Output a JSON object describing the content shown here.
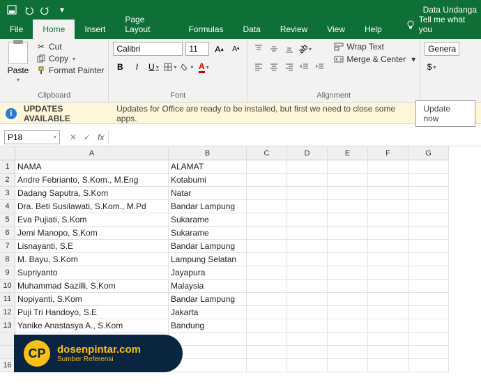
{
  "titlebar": {
    "doc": "Data Undanga"
  },
  "tabs": {
    "file": "File",
    "home": "Home",
    "insert": "Insert",
    "layout": "Page Layout",
    "formulas": "Formulas",
    "data": "Data",
    "review": "Review",
    "view": "View",
    "help": "Help",
    "tellme": "Tell me what you"
  },
  "clipboard": {
    "paste": "Paste",
    "cut": "Cut",
    "copy": "Copy",
    "fmt": "Format Painter",
    "label": "Clipboard"
  },
  "font": {
    "name": "Calibri",
    "size": "11",
    "label": "Font"
  },
  "align": {
    "wrap": "Wrap Text",
    "merge": "Merge & Center",
    "label": "Alignment"
  },
  "number": {
    "fmt": "Genera"
  },
  "notif": {
    "title": "UPDATES AVAILABLE",
    "msg": "Updates for Office are ready to be installed, but first we need to close some apps.",
    "btn": "Update now"
  },
  "namebox": "P18",
  "fx": "fx",
  "cols": [
    "A",
    "B",
    "C",
    "D",
    "E",
    "F",
    "G"
  ],
  "rows": [
    "1",
    "2",
    "3",
    "4",
    "5",
    "6",
    "7",
    "8",
    "9",
    "10",
    "11",
    "12",
    "13",
    "",
    "",
    "16"
  ],
  "data": [
    [
      "NAMA",
      "ALAMAT",
      "",
      "",
      "",
      "",
      ""
    ],
    [
      "Andre Febrianto, S.Kom., M.Eng",
      "Kotabumi",
      "",
      "",
      "",
      "",
      ""
    ],
    [
      "Dadang Saputra, S.Kom",
      "Natar",
      "",
      "",
      "",
      "",
      ""
    ],
    [
      "Dra. Beti Susilawati, S.Kom., M.Pd",
      "Bandar Lampung",
      "",
      "",
      "",
      "",
      ""
    ],
    [
      "Eva Pujiati, S.Kom",
      "Sukarame",
      "",
      "",
      "",
      "",
      ""
    ],
    [
      "Jemi Manopo, S.Kom",
      "Sukarame",
      "",
      "",
      "",
      "",
      ""
    ],
    [
      "Lisnayanti, S.E",
      "Bandar Lampung",
      "",
      "",
      "",
      "",
      ""
    ],
    [
      "M. Bayu, S.Kom",
      "Lampung Selatan",
      "",
      "",
      "",
      "",
      ""
    ],
    [
      "Supriyanto",
      "Jayapura",
      "",
      "",
      "",
      "",
      ""
    ],
    [
      "Muhammad Sazilli, S.Kom",
      "Malaysia",
      "",
      "",
      "",
      "",
      ""
    ],
    [
      "Nopiyanti, S.Kom",
      "Bandar Lampung",
      "",
      "",
      "",
      "",
      ""
    ],
    [
      "Puji Tri Handoyo, S.E",
      "Jakarta",
      "",
      "",
      "",
      "",
      ""
    ],
    [
      "Yanike Anastasya A., S.Kom",
      "Bandung",
      "",
      "",
      "",
      "",
      ""
    ],
    [
      "",
      "",
      "",
      "",
      "",
      "",
      ""
    ],
    [
      "",
      "",
      "",
      "",
      "",
      "",
      ""
    ],
    [
      "",
      "",
      "",
      "",
      "",
      "",
      ""
    ]
  ],
  "wm": {
    "site": "dosenpintar.com",
    "sub": "Sumber Referensi"
  }
}
